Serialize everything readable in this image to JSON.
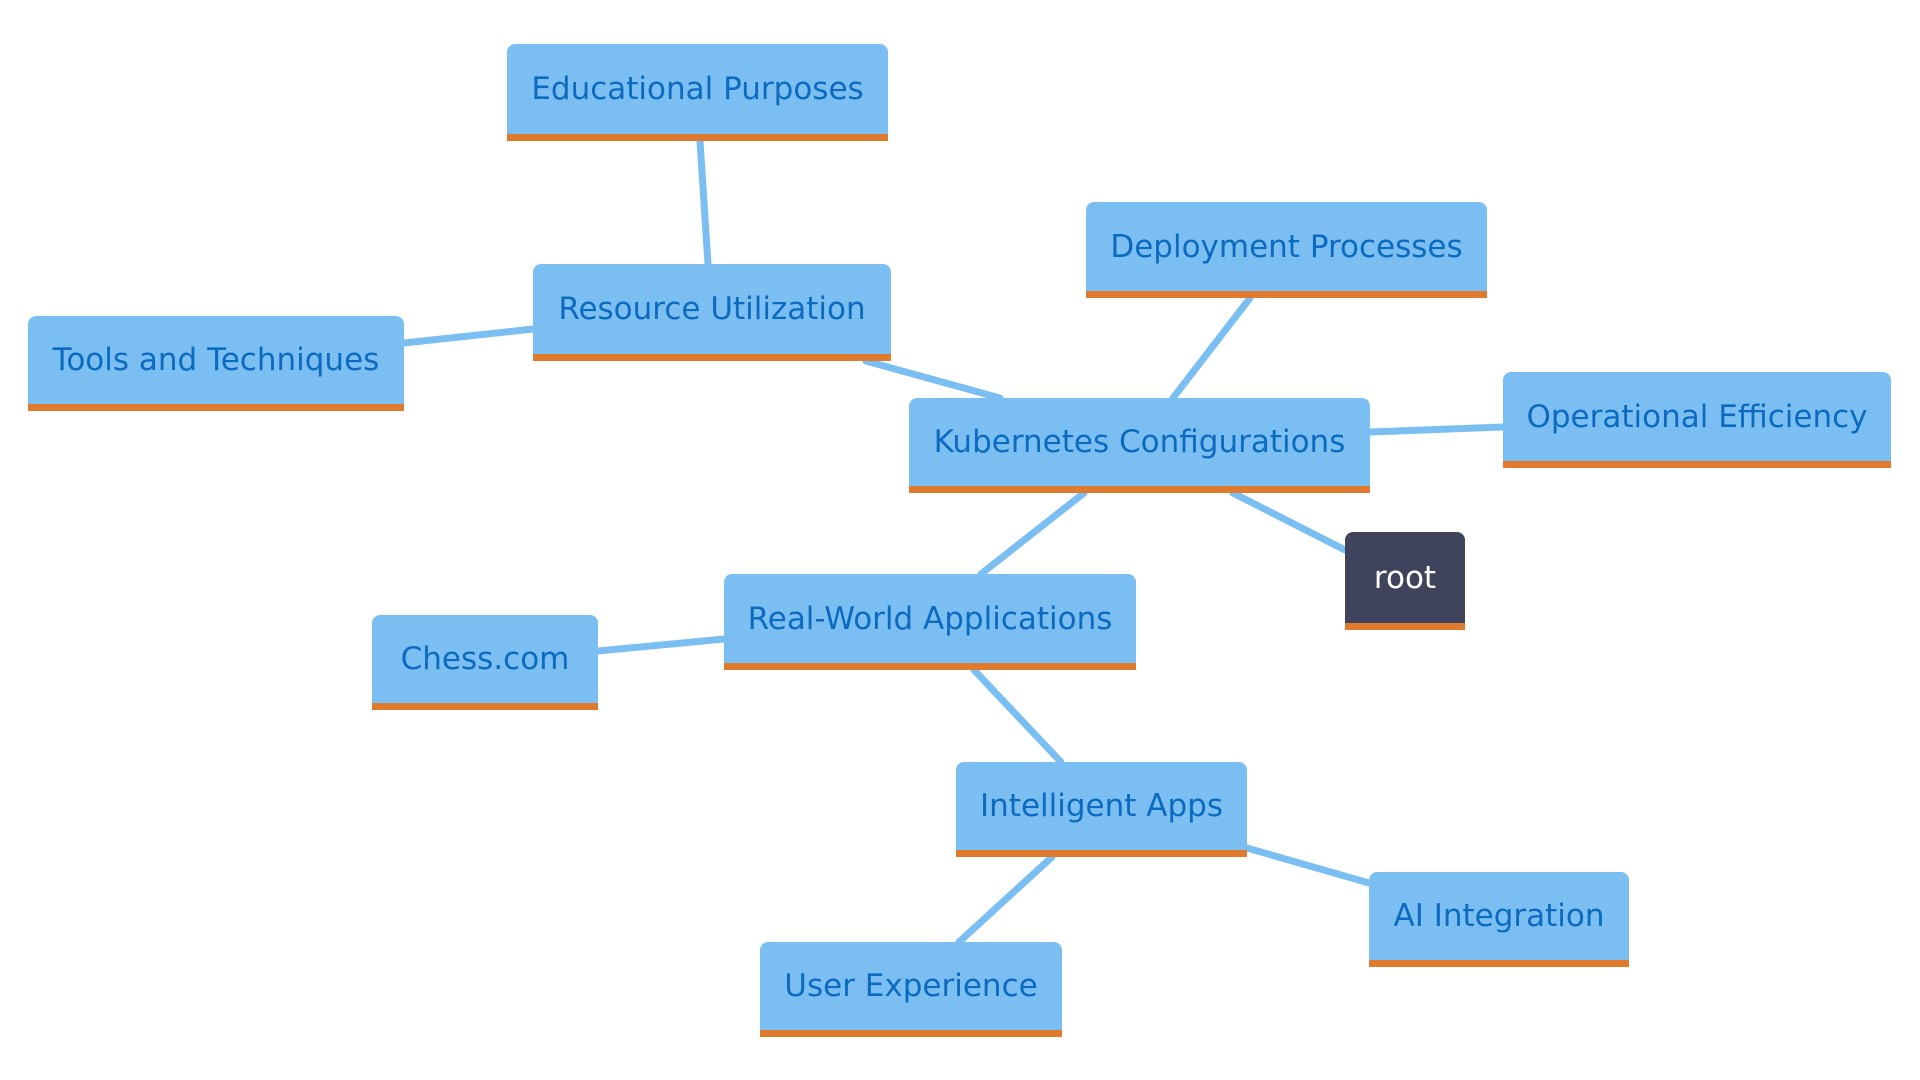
{
  "diagram": {
    "type": "mindmap",
    "colors": {
      "node_fill": "#7bbff2",
      "node_text": "#0c6bbf",
      "node_underline": "#e07b2e",
      "root_fill": "#3f445c",
      "root_text": "#ffffff",
      "edge": "#7bbff2"
    },
    "nodes": {
      "root": "root",
      "kubernetes": "Kubernetes Configurations",
      "resource": "Resource Utilization",
      "educational": "Educational Purposes",
      "tools": "Tools and Techniques",
      "deployment": "Deployment Processes",
      "operational": "Operational Efficiency",
      "realworld": "Real-World Applications",
      "chess": "Chess.com",
      "intelligent": "Intelligent Apps",
      "ai": "AI Integration",
      "ux": "User Experience"
    },
    "edges": [
      [
        "root",
        "kubernetes"
      ],
      [
        "kubernetes",
        "resource"
      ],
      [
        "resource",
        "educational"
      ],
      [
        "resource",
        "tools"
      ],
      [
        "kubernetes",
        "deployment"
      ],
      [
        "kubernetes",
        "operational"
      ],
      [
        "kubernetes",
        "realworld"
      ],
      [
        "realworld",
        "chess"
      ],
      [
        "realworld",
        "intelligent"
      ],
      [
        "intelligent",
        "ai"
      ],
      [
        "intelligent",
        "ux"
      ]
    ]
  }
}
